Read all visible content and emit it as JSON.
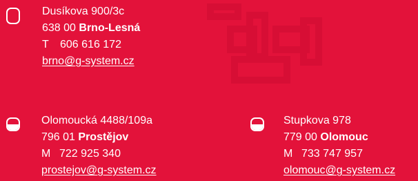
{
  "colors": {
    "background": "#e3123a",
    "text": "#ffffff",
    "watermark": "#d10d33"
  },
  "branches": [
    {
      "flag_icon": "flag-white-icon",
      "street": "Dusíkova 900/3c",
      "postal": "638 00",
      "city": "Brno-Lesná",
      "phone_prefix": "T",
      "phone": "606 616 172",
      "email": "brno@g-system.cz"
    },
    {
      "flag_icon": "flag-half-white-icon",
      "street": "Olomoucká 4488/109a",
      "postal": "796 01",
      "city": "Prostějov",
      "phone_prefix": "M",
      "phone": "722 925 340",
      "email": "prostejov@g-system.cz"
    },
    {
      "flag_icon": "flag-half-white-icon",
      "street": "Stupkova 978",
      "postal": "779 00",
      "city": "Olomouc",
      "phone_prefix": "M",
      "phone": "733 747 957",
      "email": "olomouc@g-system.cz"
    }
  ],
  "watermark_icon": "pipe-fitting-watermark-icon"
}
